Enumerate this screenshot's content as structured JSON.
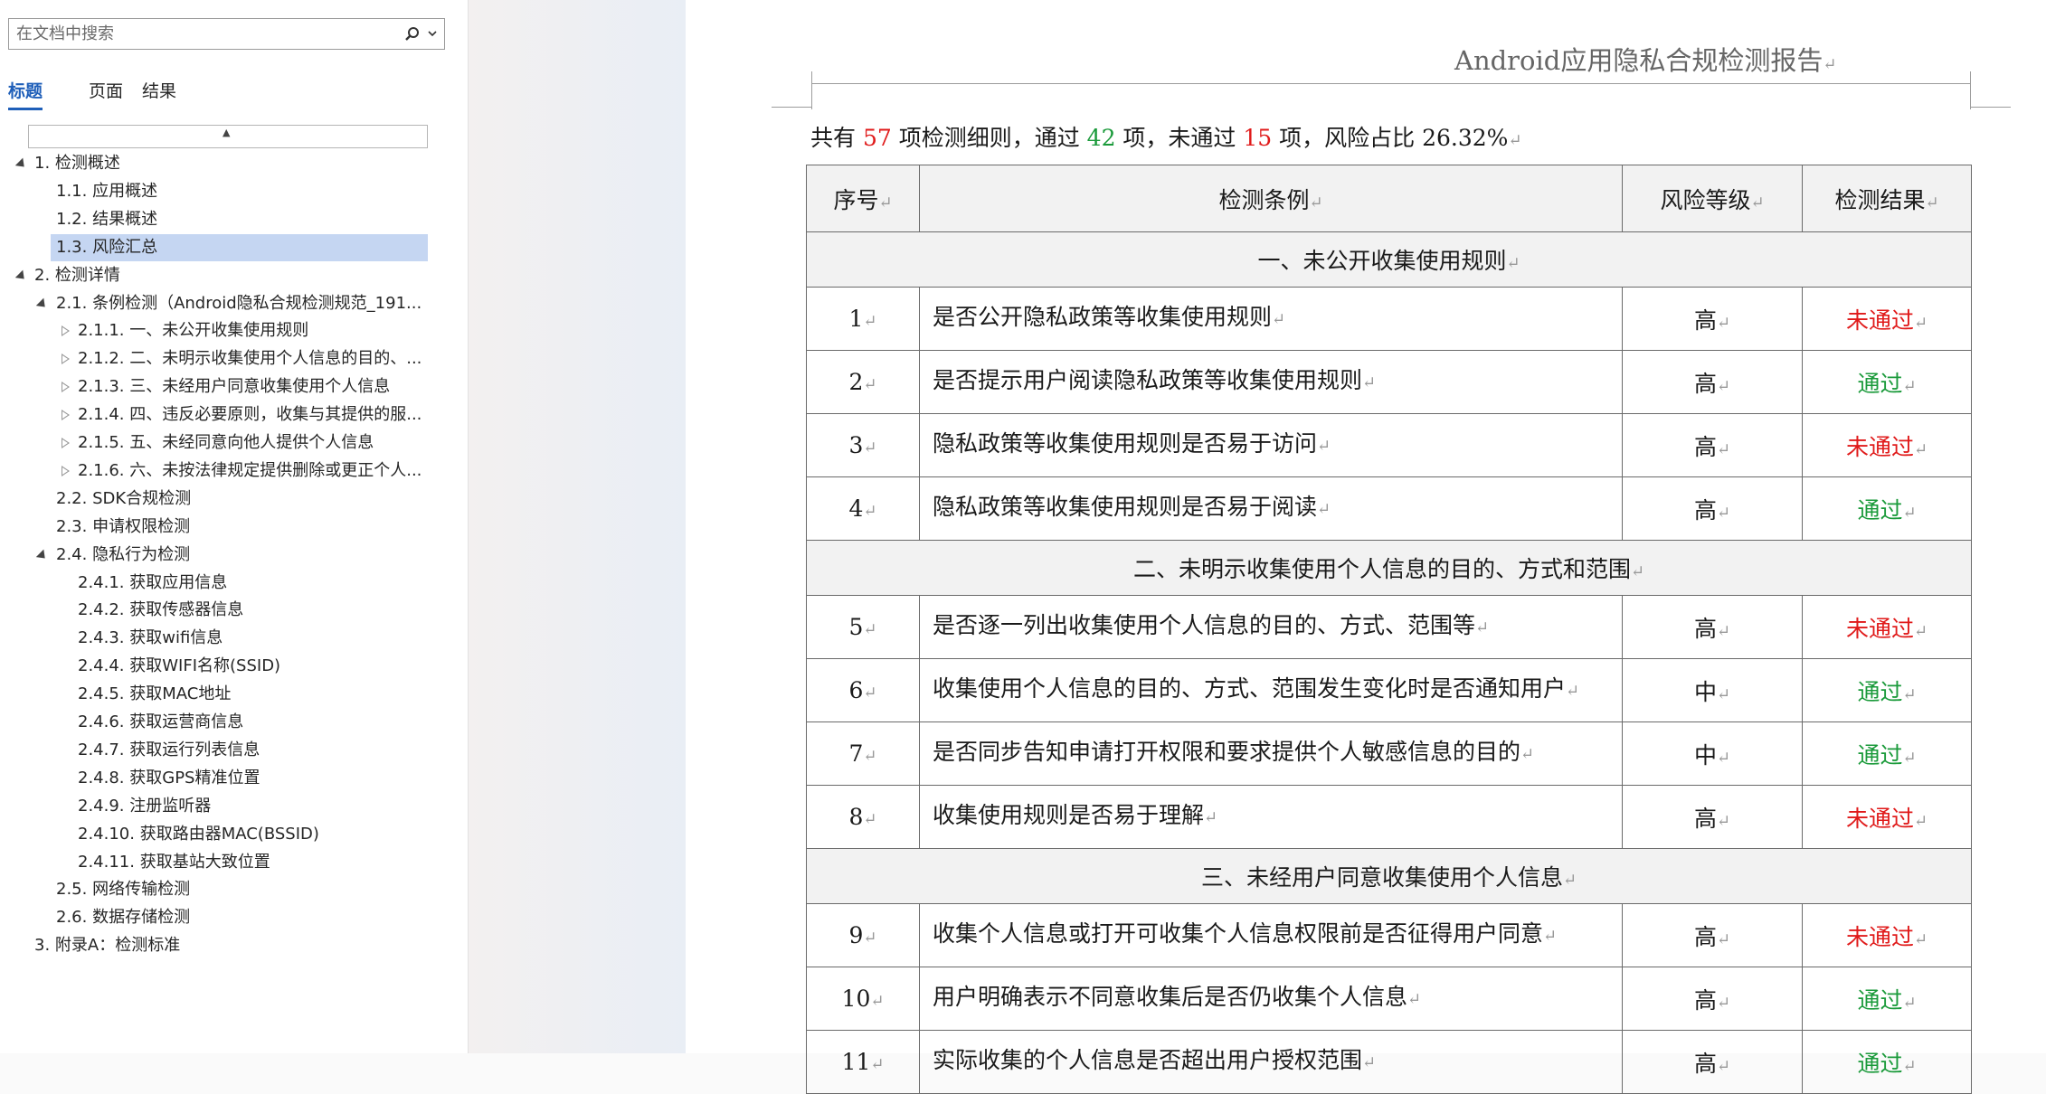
{
  "nav": {
    "search_placeholder": "在文档中搜索",
    "tabs": [
      "标题",
      "页面",
      "结果"
    ],
    "collapse_glyph": "▲",
    "tree": [
      {
        "label": "1. 检测概述",
        "level": 0,
        "toggle": "down"
      },
      {
        "label": "1.1. 应用概述",
        "level": 1,
        "toggle": "none"
      },
      {
        "label": "1.2. 结果概述",
        "level": 1,
        "toggle": "none"
      },
      {
        "label": "1.3. 风险汇总",
        "level": 1,
        "toggle": "none",
        "selected": true
      },
      {
        "label": "2. 检测详情",
        "level": 0,
        "toggle": "down"
      },
      {
        "label": "2.1. 条例检测（Android隐私合规检测规范_191...",
        "level": 1,
        "toggle": "down"
      },
      {
        "label": "2.1.1. 一、未公开收集使用规则",
        "level": 2,
        "toggle": "right"
      },
      {
        "label": "2.1.2. 二、未明示收集使用个人信息的目的、...",
        "level": 2,
        "toggle": "right"
      },
      {
        "label": "2.1.3. 三、未经用户同意收集使用个人信息",
        "level": 2,
        "toggle": "right"
      },
      {
        "label": "2.1.4. 四、违反必要原则，收集与其提供的服...",
        "level": 2,
        "toggle": "right"
      },
      {
        "label": "2.1.5. 五、未经同意向他人提供个人信息",
        "level": 2,
        "toggle": "right"
      },
      {
        "label": "2.1.6. 六、未按法律规定提供删除或更正个人...",
        "level": 2,
        "toggle": "right"
      },
      {
        "label": "2.2. SDK合规检测",
        "level": 1,
        "toggle": "none"
      },
      {
        "label": "2.3. 申请权限检测",
        "level": 1,
        "toggle": "none"
      },
      {
        "label": "2.4. 隐私行为检测",
        "level": 1,
        "toggle": "down"
      },
      {
        "label": "2.4.1. 获取应用信息",
        "level": 2,
        "toggle": "none"
      },
      {
        "label": "2.4.2. 获取传感器信息",
        "level": 2,
        "toggle": "none"
      },
      {
        "label": "2.4.3. 获取wifi信息",
        "level": 2,
        "toggle": "none"
      },
      {
        "label": "2.4.4. 获取WIFI名称(SSID)",
        "level": 2,
        "toggle": "none"
      },
      {
        "label": "2.4.5. 获取MAC地址",
        "level": 2,
        "toggle": "none"
      },
      {
        "label": "2.4.6. 获取运营商信息",
        "level": 2,
        "toggle": "none"
      },
      {
        "label": "2.4.7. 获取运行列表信息",
        "level": 2,
        "toggle": "none"
      },
      {
        "label": "2.4.8. 获取GPS精准位置",
        "level": 2,
        "toggle": "none"
      },
      {
        "label": "2.4.9. 注册监听器",
        "level": 2,
        "toggle": "none"
      },
      {
        "label": "2.4.10. 获取路由器MAC(BSSID)",
        "level": 2,
        "toggle": "none"
      },
      {
        "label": "2.4.11. 获取基站大致位置",
        "level": 2,
        "toggle": "none"
      },
      {
        "label": "2.5. 网络传输检测",
        "level": 1,
        "toggle": "none"
      },
      {
        "label": "2.6. 数据存储检测",
        "level": 1,
        "toggle": "none"
      },
      {
        "label": "3. 附录A：检测标准",
        "level": 0,
        "toggle": "none"
      }
    ]
  },
  "doc": {
    "header_title": "Android应用隐私合规检测报告",
    "paragraph_mark": "↵",
    "summary": {
      "p1": "共有 ",
      "total": "57",
      "p2": " 项检测细则，通过 ",
      "passed": "42",
      "p3": " 项，未通过 ",
      "failed": "15",
      "p4": " 项，风险占比 26.32%"
    },
    "colors": {
      "fail": "#e01a1a",
      "pass": "#1a9a3a"
    },
    "table": {
      "headers": [
        "序号",
        "检测条例",
        "风险等级",
        "检测结果"
      ],
      "rows": [
        {
          "type": "section",
          "title": "一、未公开收集使用规则"
        },
        {
          "type": "item",
          "no": "1",
          "rule": "是否公开隐私政策等收集使用规则",
          "risk": "高",
          "result": "未通过",
          "status": "fail"
        },
        {
          "type": "item",
          "no": "2",
          "rule": "是否提示用户阅读隐私政策等收集使用规则",
          "risk": "高",
          "result": "通过",
          "status": "pass"
        },
        {
          "type": "item",
          "no": "3",
          "rule": "隐私政策等收集使用规则是否易于访问",
          "risk": "高",
          "result": "未通过",
          "status": "fail"
        },
        {
          "type": "item",
          "no": "4",
          "rule": "隐私政策等收集使用规则是否易于阅读",
          "risk": "高",
          "result": "通过",
          "status": "pass"
        },
        {
          "type": "section",
          "title": "二、未明示收集使用个人信息的目的、方式和范围"
        },
        {
          "type": "item",
          "no": "5",
          "rule": "是否逐一列出收集使用个人信息的目的、方式、范围等",
          "risk": "高",
          "result": "未通过",
          "status": "fail"
        },
        {
          "type": "item",
          "no": "6",
          "rule": "收集使用个人信息的目的、方式、范围发生变化时是否通知用户",
          "risk": "中",
          "result": "通过",
          "status": "pass"
        },
        {
          "type": "item",
          "no": "7",
          "rule": "是否同步告知申请打开权限和要求提供个人敏感信息的目的",
          "risk": "中",
          "result": "通过",
          "status": "pass"
        },
        {
          "type": "item",
          "no": "8",
          "rule": "收集使用规则是否易于理解",
          "risk": "高",
          "result": "未通过",
          "status": "fail"
        },
        {
          "type": "section",
          "title": "三、未经用户同意收集使用个人信息"
        },
        {
          "type": "item",
          "no": "9",
          "rule": "收集个人信息或打开可收集个人信息权限前是否征得用户同意",
          "risk": "高",
          "result": "未通过",
          "status": "fail"
        },
        {
          "type": "item",
          "no": "10",
          "rule": "用户明确表示不同意收集后是否仍收集个人信息",
          "risk": "高",
          "result": "通过",
          "status": "pass"
        },
        {
          "type": "item",
          "no": "11",
          "rule": "实际收集的个人信息是否超出用户授权范围",
          "risk": "高",
          "result": "通过",
          "status": "pass"
        }
      ]
    }
  }
}
